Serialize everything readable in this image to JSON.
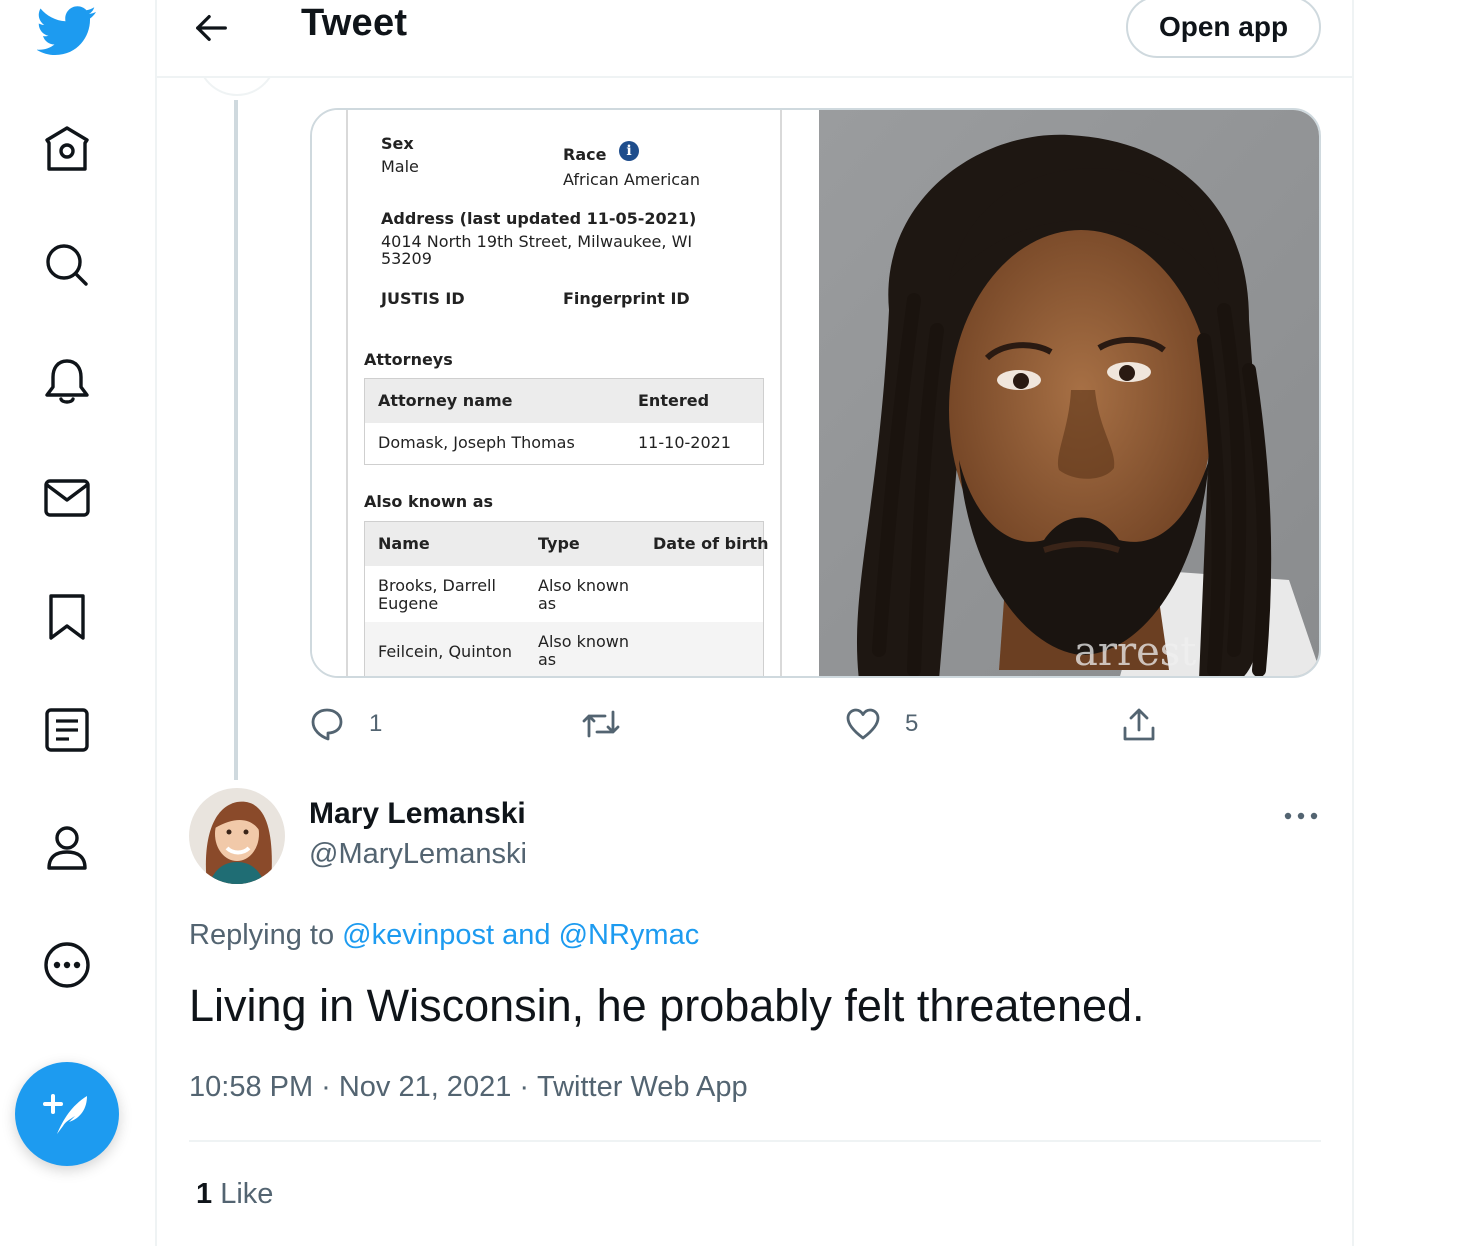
{
  "colors": {
    "accent": "#1d9bf0",
    "text_primary": "#0f1419",
    "text_secondary": "#536471",
    "border": "#cfd9de"
  },
  "sidebar": {
    "items": [
      {
        "icon": "twitter-logo-icon"
      },
      {
        "icon": "home-icon"
      },
      {
        "icon": "search-icon"
      },
      {
        "icon": "notifications-bell-icon"
      },
      {
        "icon": "messages-envelope-icon"
      },
      {
        "icon": "bookmark-icon"
      },
      {
        "icon": "lists-icon"
      },
      {
        "icon": "profile-icon"
      },
      {
        "icon": "more-circle-icon"
      }
    ],
    "compose_icon": "compose-feather-icon"
  },
  "header": {
    "title": "Tweet",
    "open_app_label": "Open app"
  },
  "media": {
    "document": {
      "sex_label": "Sex",
      "sex_value": "Male",
      "race_label": "Race",
      "race_value": "African American",
      "address_label": "Address (last updated 11-05-2021)",
      "address_line1": "4014 North 19th Street, Milwaukee, WI",
      "address_line2": "53209",
      "justis_label": "JUSTIS ID",
      "fingerprint_label": "Fingerprint ID",
      "attorneys_heading": "Attorneys",
      "attorneys_table": {
        "headers": [
          "Attorney name",
          "Entered"
        ],
        "rows": [
          [
            "Domask, Joseph Thomas",
            "11-10-2021"
          ]
        ]
      },
      "aka_heading": "Also known as",
      "aka_table": {
        "headers": [
          "Name",
          "Type",
          "Date of birth"
        ],
        "rows": [
          {
            "name_l1": "Brooks, Darrell",
            "name_l2": "Eugene",
            "type_l1": "Also known",
            "type_l2": "as"
          },
          {
            "name_l1": "Feilcein, Quinton",
            "name_l2": "",
            "type_l1": "Also known",
            "type_l2": "as"
          }
        ]
      }
    },
    "photo": {
      "watermark": "arrest"
    }
  },
  "actions": {
    "reply_count": "1",
    "retweet_count": "",
    "like_count": "5"
  },
  "reply_tweet": {
    "author_name": "Mary Lemanski",
    "author_handle": "@MaryLemanski",
    "replying_prefix": "Replying to",
    "replying_targets": "@kevinpost and @NRymac",
    "text": "Living in Wisconsin, he probably felt threatened.",
    "time": "10:58 PM",
    "date": "Nov 21, 2021",
    "source": "Twitter Web App",
    "likes_count": "1",
    "likes_label": "Like"
  }
}
